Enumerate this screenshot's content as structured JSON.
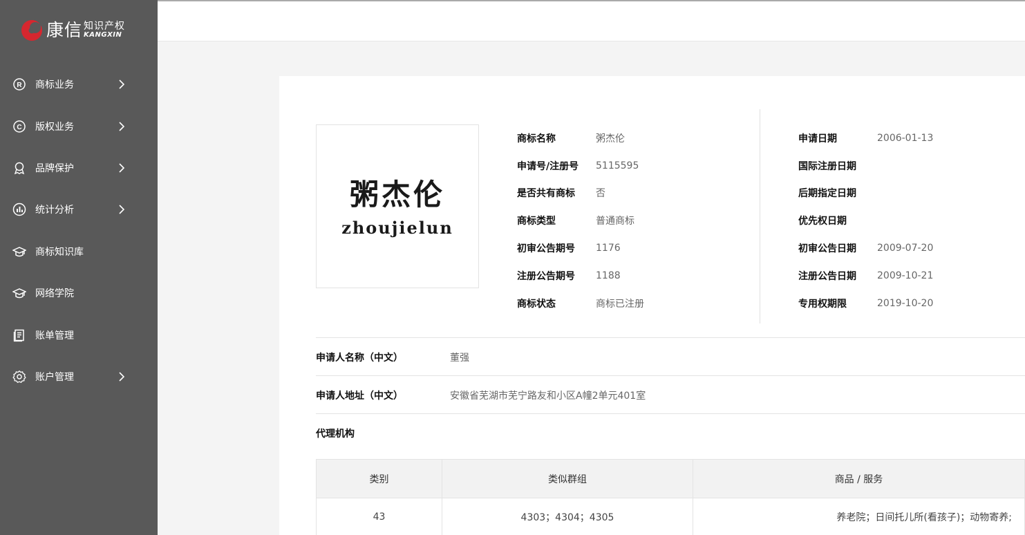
{
  "brand": {
    "name_cn": "康信",
    "sub_cn": "知识产权",
    "sub_en": "KANGXIN",
    "accent": "#d6272f"
  },
  "nav": {
    "items": [
      {
        "label": "商标业务",
        "icon": "registered-icon",
        "has_arrow": true
      },
      {
        "label": "版权业务",
        "icon": "copyright-icon",
        "has_arrow": true
      },
      {
        "label": "品牌保护",
        "icon": "award-icon",
        "has_arrow": true
      },
      {
        "label": "统计分析",
        "icon": "chart-icon",
        "has_arrow": true
      },
      {
        "label": "商标知识库",
        "icon": "graduation-cap-icon",
        "has_arrow": false
      },
      {
        "label": "网络学院",
        "icon": "graduation-cap-icon",
        "has_arrow": false
      },
      {
        "label": "账单管理",
        "icon": "bill-icon",
        "has_arrow": false
      },
      {
        "label": "账户管理",
        "icon": "gear-icon",
        "has_arrow": true
      }
    ]
  },
  "trademark": {
    "image_cn": "粥杰伦",
    "image_pinyin": "zhoujielun"
  },
  "info_left": [
    {
      "label": "商标名称",
      "value": "粥杰伦"
    },
    {
      "label": "申请号/注册号",
      "value": "5115595"
    },
    {
      "label": "是否共有商标",
      "value": "否"
    },
    {
      "label": "商标类型",
      "value": "普通商标"
    },
    {
      "label": "初审公告期号",
      "value": "1176"
    },
    {
      "label": "注册公告期号",
      "value": "1188"
    },
    {
      "label": "商标状态",
      "value": "商标已注册"
    }
  ],
  "info_right": [
    {
      "label": "申请日期",
      "value": "2006-01-13"
    },
    {
      "label": "国际注册日期",
      "value": ""
    },
    {
      "label": "后期指定日期",
      "value": ""
    },
    {
      "label": "优先权日期",
      "value": ""
    },
    {
      "label": "初审公告日期",
      "value": "2009-07-20"
    },
    {
      "label": "注册公告日期",
      "value": "2009-10-21"
    },
    {
      "label": "专用权期限",
      "value": "2019-10-20"
    }
  ],
  "applicant": {
    "name_label": "申请人名称（中文）",
    "name_value": "董强",
    "address_label": "申请人地址（中文）",
    "address_value": "安徽省芜湖市芜宁路友和小区A幢2单元401室",
    "agency_label": "代理机构",
    "agency_value": ""
  },
  "goods_table": {
    "headers": [
      "类别",
      "类似群组",
      "商品 / 服务"
    ],
    "rows": [
      {
        "class": "43",
        "groups": "4303；4304；4305",
        "goods": "养老院；日间托儿所(看孩子)；动物寄养;"
      }
    ]
  }
}
